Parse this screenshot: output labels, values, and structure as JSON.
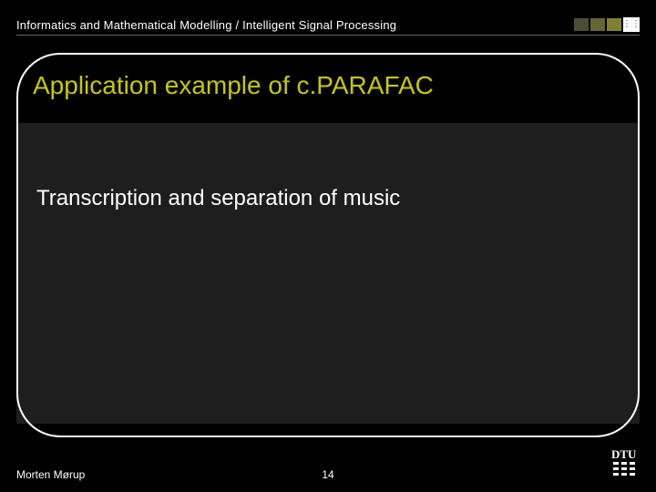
{
  "header": {
    "organization": "Informatics and Mathematical Modelling / Intelligent Signal Processing"
  },
  "slide": {
    "title": "Application example of c.PARAFAC",
    "body": "Transcription and separation of music"
  },
  "footer": {
    "author": "Morten Mørup",
    "page_number": "14"
  },
  "colors": {
    "accent": "#c8c800",
    "body_band": "#1e1e1e"
  }
}
